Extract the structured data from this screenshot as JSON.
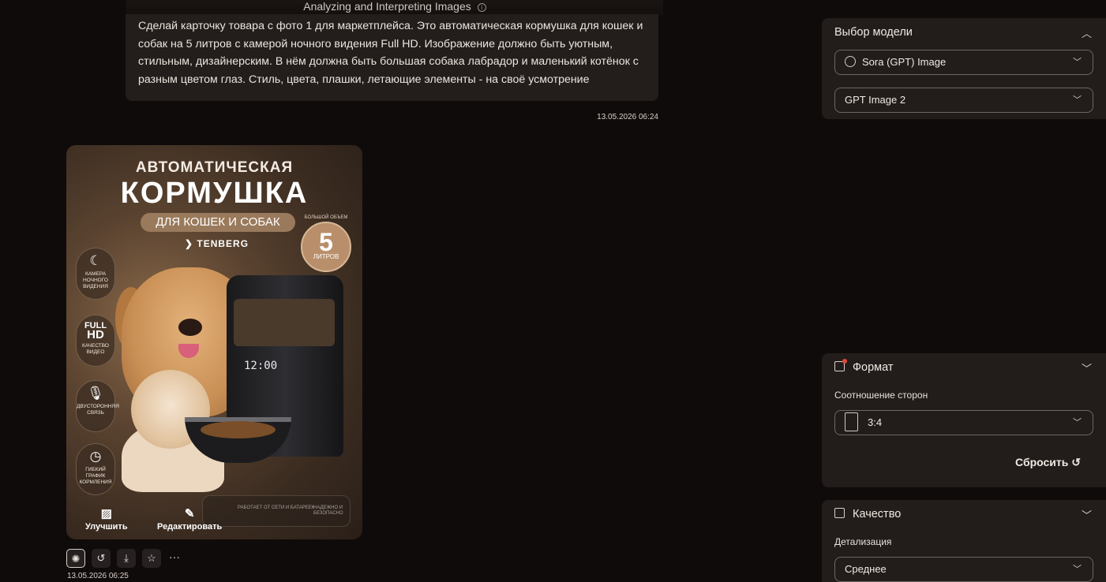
{
  "chat": {
    "top_label": "Analyzing and Interpreting Images",
    "prompt_text": "Сделай карточку товара с фото 1 для маркетплейса. Это автоматическая кормушка для кошек и собак на 5 литров с камерой ночного видения Full HD. Изображение должно быть уютным, стильным, дизайнерским. В нём должна быть большая собака лабрадор и маленький котёнок с разным цветом глаз. Стиль, цвета, плашки, летающие элементы - на своё усмотрение",
    "prompt_timestamp": "13.05.2026 06:24",
    "result_timestamp": "13.05.2026 06:25"
  },
  "product_card": {
    "title_line1": "АВТОМАТИЧЕСКАЯ",
    "title_line2": "КОРМУШКА",
    "pill": "ДЛЯ КОШЕК И СОБАК",
    "brand": "TENBERG",
    "volume_small": "БОЛЬШОЙ ОБЪЕМ",
    "volume_number": "5",
    "volume_unit": "ЛИТРОВ",
    "features": [
      {
        "icon": "moon-camera-icon",
        "text": "КАМЕРА НОЧНОГО ВИДЕНИЯ"
      },
      {
        "icon": "full-hd-icon",
        "text": "КАЧЕСТВО ВИДЕО"
      },
      {
        "icon": "microphone-icon",
        "text": "ДВУСТОРОННЯЯ СВЯЗЬ"
      },
      {
        "icon": "clock-icon",
        "text": "ГИБКИЙ ГРАФИК КОРМЛЕНИЯ"
      }
    ],
    "full_hd_line1": "FULL",
    "full_hd_line2": "HD",
    "display_time": "12:00",
    "bottom_left": "РАБОТАЕТ ОТ СЕТИ И БАТАРЕЕК",
    "bottom_right": "НАДЕЖНО И БЕЗОПАСНО",
    "action_improve": "Улучшить",
    "action_edit": "Редактировать"
  },
  "result_actions": {
    "more_label": "···"
  },
  "sidebar": {
    "model_section": {
      "title": "Выбор модели",
      "provider": "Sora (GPT) Image",
      "model": "GPT Image 2"
    },
    "format_section": {
      "title": "Формат",
      "ratio_label": "Соотношение сторон",
      "ratio_value": "3:4",
      "reset_label": "Сбросить"
    },
    "quality_section": {
      "title": "Качество",
      "detail_label": "Детализация",
      "detail_value": "Среднее"
    }
  }
}
